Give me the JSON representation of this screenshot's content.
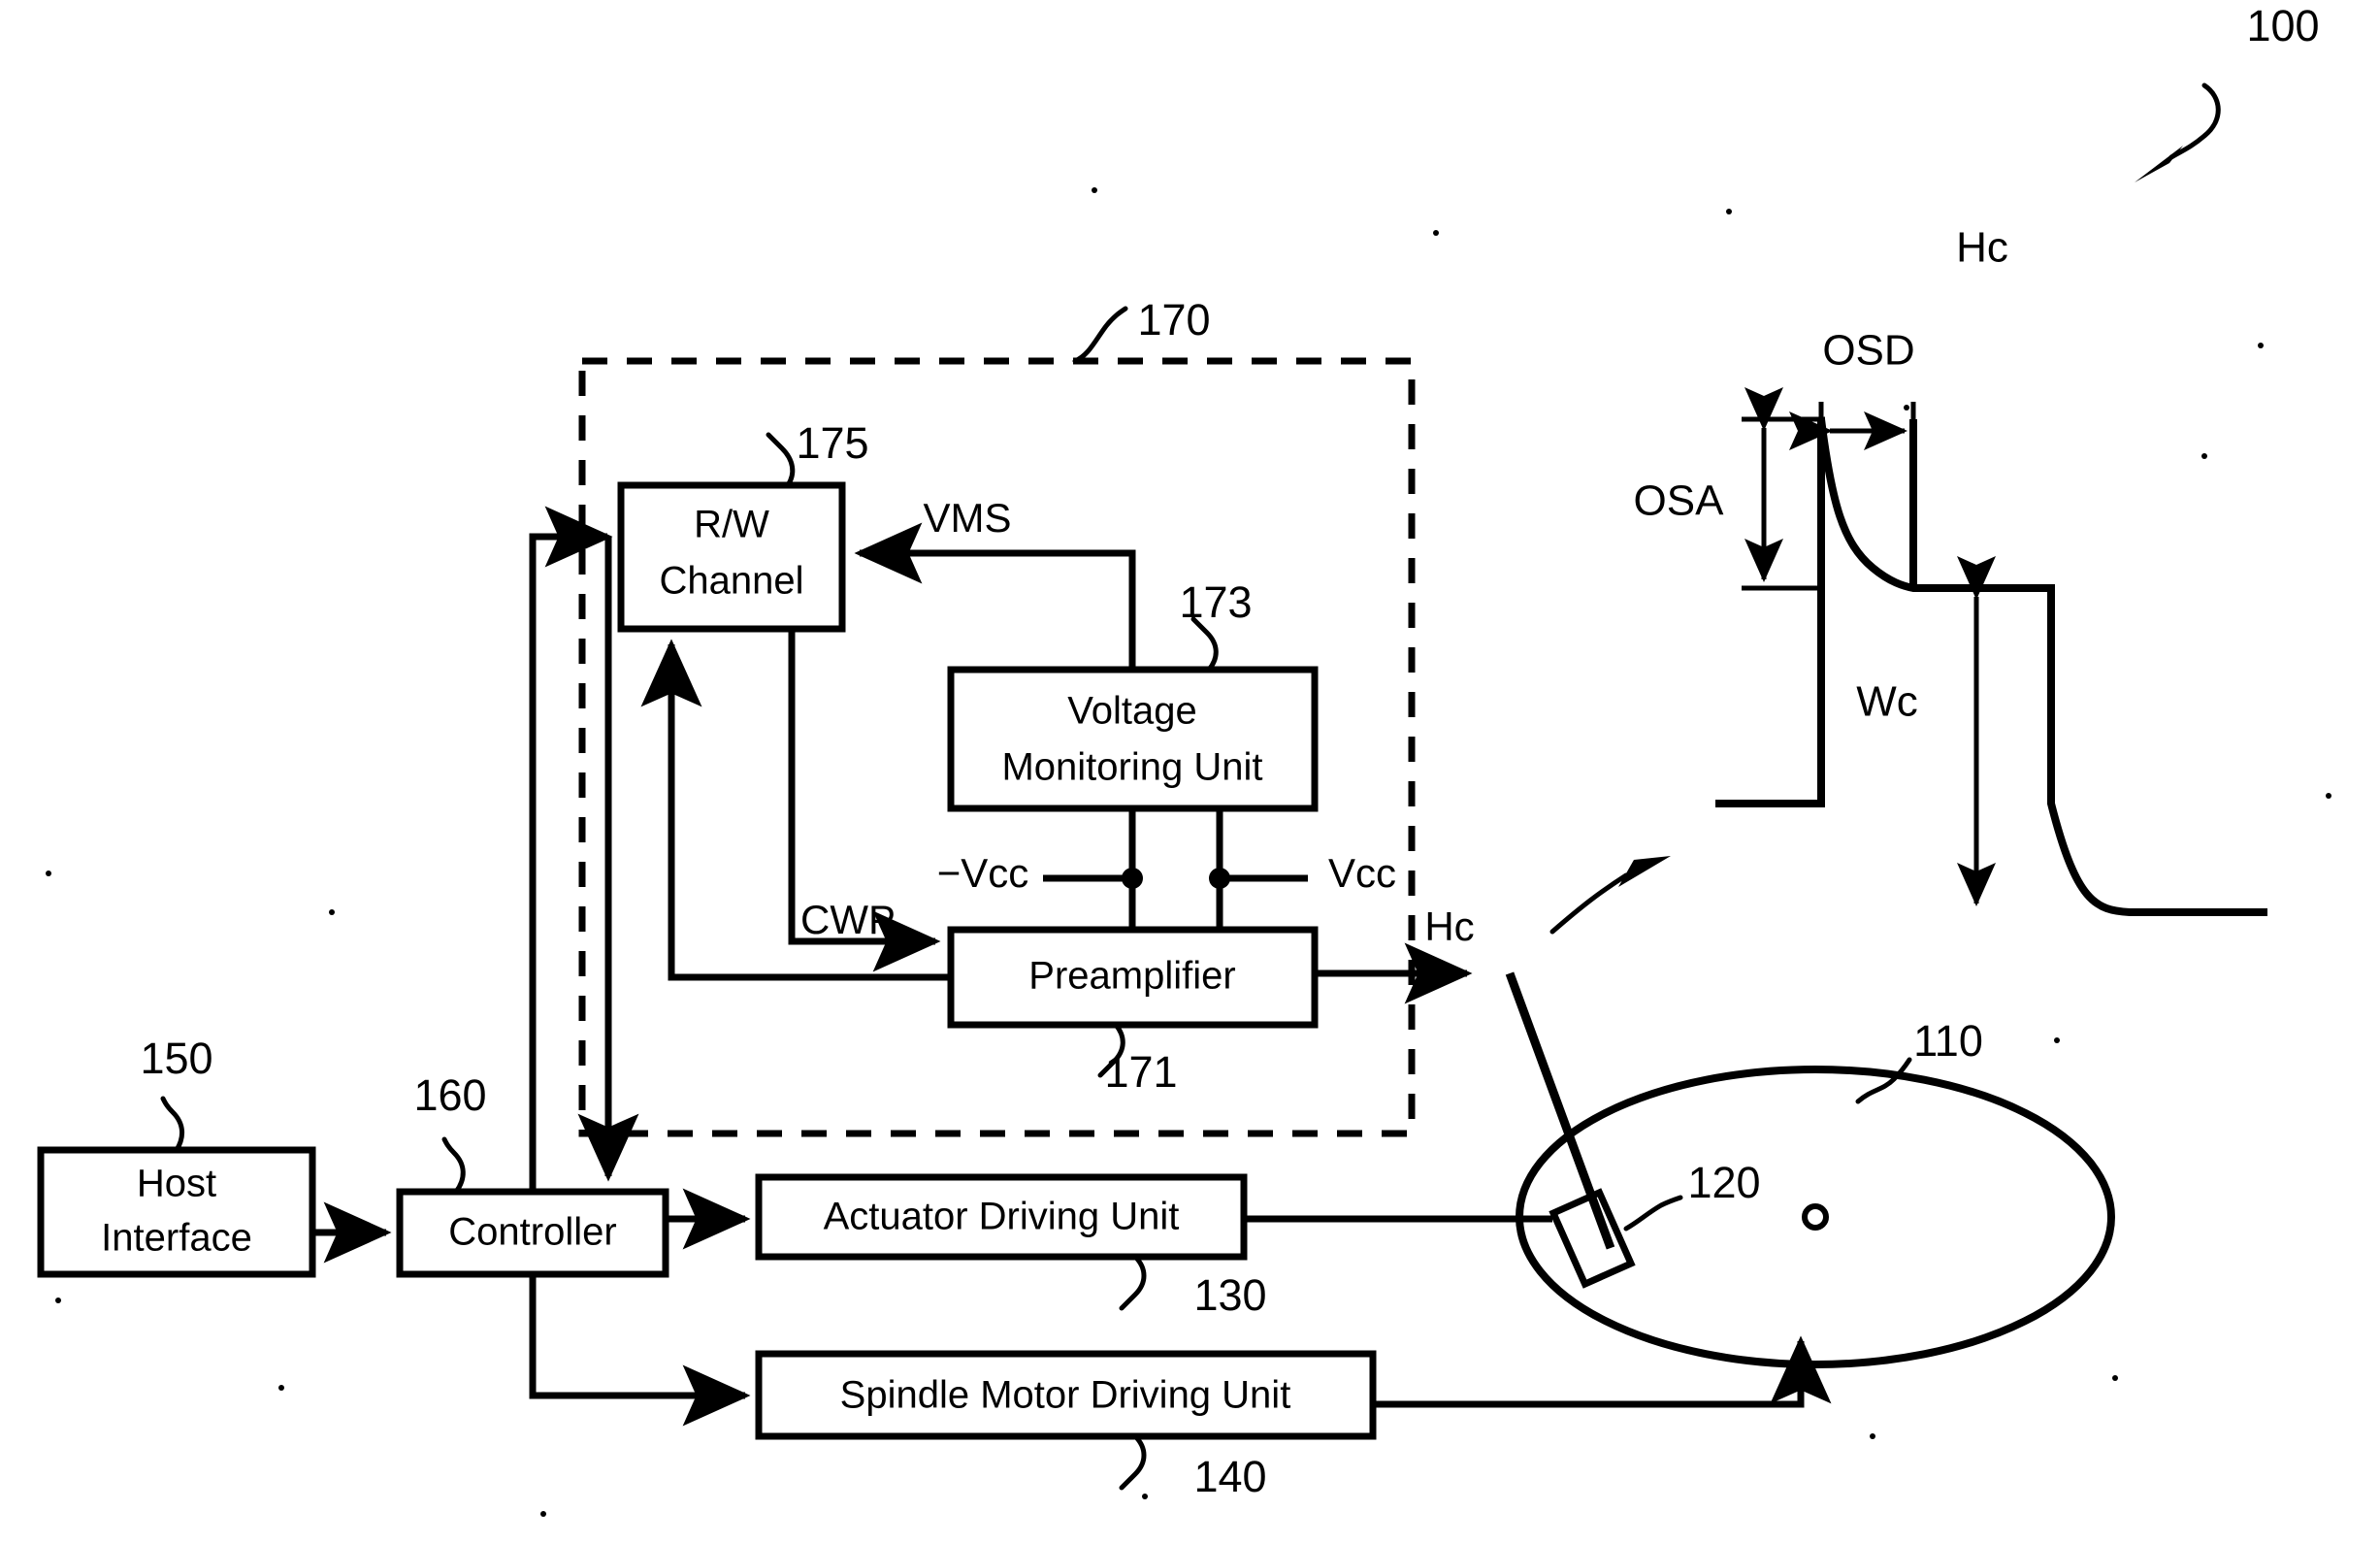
{
  "figure": {
    "reference_number": "100",
    "title_visible": false
  },
  "blocks": [
    {
      "id": "host_interface",
      "label_line1": "Host",
      "label_line2": "Interface",
      "ref": "150"
    },
    {
      "id": "controller",
      "label_line1": "Controller",
      "label_line2": "",
      "ref": "160"
    },
    {
      "id": "actuator_driver",
      "label_line1": "Actuator Driving Unit",
      "label_line2": "",
      "ref": "130"
    },
    {
      "id": "spindle_driver",
      "label_line1": "Spindle Motor Driving Unit",
      "label_line2": "",
      "ref": "140"
    },
    {
      "id": "rw_channel",
      "label_line1": "R/W",
      "label_line2": "Channel",
      "ref": "175"
    },
    {
      "id": "voltage_monitor",
      "label_line1": "Voltage",
      "label_line2": "Monitoring Unit",
      "ref": "173"
    },
    {
      "id": "preamplifier",
      "label_line1": "Preamplifier",
      "label_line2": "",
      "ref": "171"
    }
  ],
  "dashed_group": {
    "ref": "170"
  },
  "disk_assembly": {
    "disk_ref": "110",
    "head_ref": "120"
  },
  "signals": {
    "vms": "VMS",
    "cwp": "CWP",
    "vcc_neg": "−Vcc",
    "vcc_pos": "Vcc",
    "hc_head": "Hc"
  },
  "waveform": {
    "title": "Hc",
    "osd": "OSD",
    "osa": "OSA",
    "wc": "Wc"
  },
  "chart_data": {
    "type": "line",
    "title": "Hc",
    "xlabel": "",
    "ylabel": "",
    "annotations": [
      "OSD",
      "OSA",
      "Wc"
    ],
    "description": "Write current waveform with overshoot. Baseline at 0, rises to overshoot peak, decays exponentially to steady-state plateau, then falls below baseline with undershoot and recovers.",
    "segments": [
      {
        "name": "baseline-left",
        "x": [
          0.0,
          0.22
        ],
        "y": [
          0.0,
          0.0
        ]
      },
      {
        "name": "rising-edge",
        "x": [
          0.22,
          0.22
        ],
        "y": [
          0.0,
          1.0
        ]
      },
      {
        "name": "overshoot-decay",
        "x": [
          0.22,
          0.44
        ],
        "y": [
          1.0,
          0.62
        ]
      },
      {
        "name": "plateau",
        "x": [
          0.44,
          0.62
        ],
        "y": [
          0.62,
          0.62
        ]
      },
      {
        "name": "falling-edge",
        "x": [
          0.62,
          0.62
        ],
        "y": [
          0.62,
          -0.22
        ]
      },
      {
        "name": "undershoot-recovery",
        "x": [
          0.62,
          0.8
        ],
        "y": [
          -0.22,
          0.0
        ]
      },
      {
        "name": "baseline-right",
        "x": [
          0.8,
          1.0
        ],
        "y": [
          0.0,
          0.0
        ]
      }
    ],
    "measures": {
      "OSD": {
        "meaning": "overshoot duration",
        "x_from": 0.22,
        "x_to": 0.44
      },
      "OSA": {
        "meaning": "overshoot amplitude",
        "y_from": 0.62,
        "y_to": 1.0
      },
      "Wc": {
        "meaning": "write current level",
        "y_from": 0.0,
        "y_to": 0.62
      }
    }
  }
}
